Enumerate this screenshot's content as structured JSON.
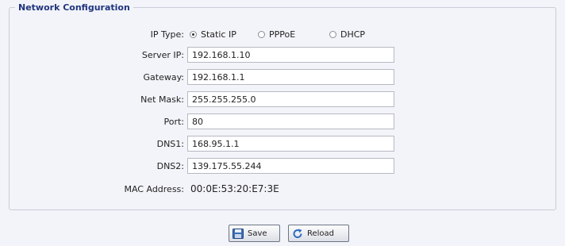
{
  "panel": {
    "title": "Network Configuration"
  },
  "ip_type": {
    "label": "IP Type:",
    "options": [
      "Static IP",
      "PPPoE",
      "DHCP"
    ],
    "selected": "Static IP"
  },
  "fields": {
    "server_ip": {
      "label": "Server IP:",
      "value": "192.168.1.10"
    },
    "gateway": {
      "label": "Gateway:",
      "value": "192.168.1.1"
    },
    "net_mask": {
      "label": "Net Mask:",
      "value": "255.255.255.0"
    },
    "port": {
      "label": "Port:",
      "value": "80"
    },
    "dns1": {
      "label": "DNS1:",
      "value": "168.95.1.1"
    },
    "dns2": {
      "label": "DNS2:",
      "value": "139.175.55.244"
    }
  },
  "mac": {
    "label": "MAC Address:",
    "value": "00:0E:53:20:E7:3E"
  },
  "buttons": {
    "save": "Save",
    "reload": "Reload"
  },
  "colors": {
    "title": "#20357e",
    "background": "#f3f4f9",
    "border": "#c9ccd8"
  }
}
